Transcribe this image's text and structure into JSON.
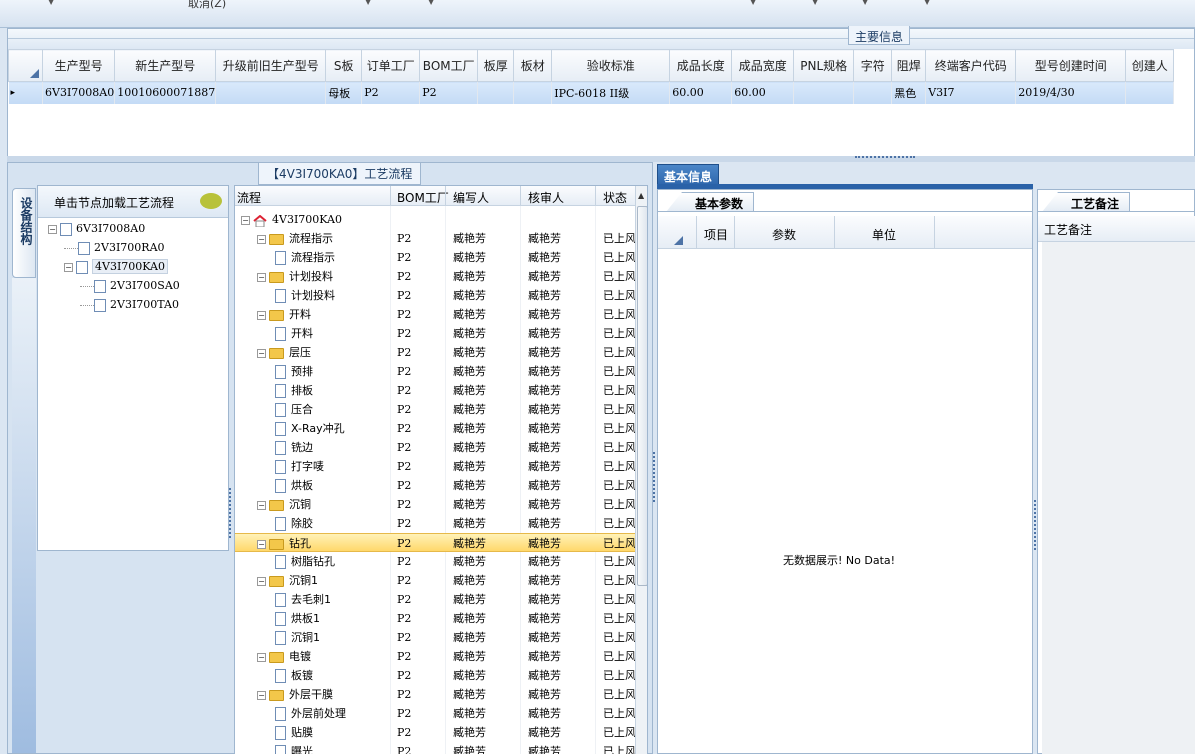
{
  "toolbar": {
    "cancel_label": "取消(Z)"
  },
  "main_info": {
    "title": "主要信息",
    "columns": [
      "生产型号",
      "新生产型号",
      "升级前旧生产型号",
      "S板",
      "订单工厂",
      "BOM工厂",
      "板厚",
      "板材",
      "验收标准",
      "成品长度",
      "成品宽度",
      "PNL规格",
      "字符",
      "阻焊",
      "终端客户代码",
      "型号创建时间",
      "创建人"
    ],
    "row": [
      "6V3I7008A0",
      "10010600071887",
      "",
      "母板",
      "P2",
      "P2",
      "",
      "",
      "IPC-6018 II级",
      "60.00",
      "60.00",
      "",
      "",
      "黑色",
      "V3I7",
      "2019/4/30",
      ""
    ]
  },
  "left_panel": {
    "title": "【4V3I700KA0】工艺流程",
    "side_tab": "设备结构",
    "tree_header": "单击节点加载工艺流程",
    "tree": [
      {
        "label": "6V3I7008A0",
        "expander": "−"
      },
      {
        "label": "2V3I700RA0",
        "expander": ""
      },
      {
        "label": "4V3I700KA0",
        "expander": "−"
      },
      {
        "label": "2V3I700SA0",
        "expander": ""
      },
      {
        "label": "2V3I700TA0",
        "expander": ""
      }
    ]
  },
  "flow": {
    "headers": [
      "流程",
      "BOM工厂",
      "编写人",
      "核审人",
      "状态"
    ],
    "rows": [
      {
        "name": "4V3I700KA0",
        "type": "root",
        "bom": "",
        "writer": "",
        "reviewer": "",
        "status": ""
      },
      {
        "name": "流程指示",
        "type": "folder",
        "bom": "P2",
        "writer": "臧艳芳",
        "reviewer": "臧艳芳",
        "status": "已上风"
      },
      {
        "name": "流程指示",
        "type": "doc",
        "bom": "P2",
        "writer": "臧艳芳",
        "reviewer": "臧艳芳",
        "status": "已上风"
      },
      {
        "name": "计划投料",
        "type": "folder",
        "bom": "P2",
        "writer": "臧艳芳",
        "reviewer": "臧艳芳",
        "status": "已上风"
      },
      {
        "name": "计划投料",
        "type": "doc",
        "bom": "P2",
        "writer": "臧艳芳",
        "reviewer": "臧艳芳",
        "status": "已上风"
      },
      {
        "name": "开料",
        "type": "folder",
        "bom": "P2",
        "writer": "臧艳芳",
        "reviewer": "臧艳芳",
        "status": "已上风"
      },
      {
        "name": "开料",
        "type": "doc",
        "bom": "P2",
        "writer": "臧艳芳",
        "reviewer": "臧艳芳",
        "status": "已上风"
      },
      {
        "name": "层压",
        "type": "folder",
        "bom": "P2",
        "writer": "臧艳芳",
        "reviewer": "臧艳芳",
        "status": "已上风"
      },
      {
        "name": "预排",
        "type": "doc",
        "bom": "P2",
        "writer": "臧艳芳",
        "reviewer": "臧艳芳",
        "status": "已上风"
      },
      {
        "name": "排板",
        "type": "doc",
        "bom": "P2",
        "writer": "臧艳芳",
        "reviewer": "臧艳芳",
        "status": "已上风"
      },
      {
        "name": "压合",
        "type": "doc",
        "bom": "P2",
        "writer": "臧艳芳",
        "reviewer": "臧艳芳",
        "status": "已上风"
      },
      {
        "name": "X-Ray冲孔",
        "type": "doc",
        "bom": "P2",
        "writer": "臧艳芳",
        "reviewer": "臧艳芳",
        "status": "已上风"
      },
      {
        "name": "铣边",
        "type": "doc",
        "bom": "P2",
        "writer": "臧艳芳",
        "reviewer": "臧艳芳",
        "status": "已上风"
      },
      {
        "name": "打字唛",
        "type": "doc",
        "bom": "P2",
        "writer": "臧艳芳",
        "reviewer": "臧艳芳",
        "status": "已上风"
      },
      {
        "name": "烘板",
        "type": "doc",
        "bom": "P2",
        "writer": "臧艳芳",
        "reviewer": "臧艳芳",
        "status": "已上风"
      },
      {
        "name": "沉铜",
        "type": "folder",
        "bom": "P2",
        "writer": "臧艳芳",
        "reviewer": "臧艳芳",
        "status": "已上风"
      },
      {
        "name": "除胶",
        "type": "doc",
        "bom": "P2",
        "writer": "臧艳芳",
        "reviewer": "臧艳芳",
        "status": "已上风"
      },
      {
        "name": "钻孔",
        "type": "folder",
        "bom": "P2",
        "writer": "臧艳芳",
        "reviewer": "臧艳芳",
        "status": "已上风",
        "selected": true
      },
      {
        "name": "树脂钻孔",
        "type": "doc",
        "bom": "P2",
        "writer": "臧艳芳",
        "reviewer": "臧艳芳",
        "status": "已上风"
      },
      {
        "name": "沉铜1",
        "type": "folder",
        "bom": "P2",
        "writer": "臧艳芳",
        "reviewer": "臧艳芳",
        "status": "已上风"
      },
      {
        "name": "去毛刺1",
        "type": "doc",
        "bom": "P2",
        "writer": "臧艳芳",
        "reviewer": "臧艳芳",
        "status": "已上风"
      },
      {
        "name": "烘板1",
        "type": "doc",
        "bom": "P2",
        "writer": "臧艳芳",
        "reviewer": "臧艳芳",
        "status": "已上风"
      },
      {
        "name": "沉铜1",
        "type": "doc",
        "bom": "P2",
        "writer": "臧艳芳",
        "reviewer": "臧艳芳",
        "status": "已上风"
      },
      {
        "name": "电镀",
        "type": "folder",
        "bom": "P2",
        "writer": "臧艳芳",
        "reviewer": "臧艳芳",
        "status": "已上风"
      },
      {
        "name": "板镀",
        "type": "doc",
        "bom": "P2",
        "writer": "臧艳芳",
        "reviewer": "臧艳芳",
        "status": "已上风"
      },
      {
        "name": "外层干膜",
        "type": "folder",
        "bom": "P2",
        "writer": "臧艳芳",
        "reviewer": "臧艳芳",
        "status": "已上风"
      },
      {
        "name": "外层前处理",
        "type": "doc",
        "bom": "P2",
        "writer": "臧艳芳",
        "reviewer": "臧艳芳",
        "status": "已上风"
      },
      {
        "name": "贴膜",
        "type": "doc",
        "bom": "P2",
        "writer": "臧艳芳",
        "reviewer": "臧艳芳",
        "status": "已上风"
      },
      {
        "name": "曝光",
        "type": "doc",
        "bom": "P2",
        "writer": "臧艳芳",
        "reviewer": "臧艳芳",
        "status": "已上风"
      }
    ]
  },
  "basic_info": {
    "tab": "基本信息",
    "subtab": "基本参数",
    "columns": [
      "项目",
      "参数",
      "单位"
    ],
    "empty_message": "无数据展示! No Data!"
  },
  "remarks": {
    "subtab": "工艺备注",
    "column": "工艺备注"
  }
}
